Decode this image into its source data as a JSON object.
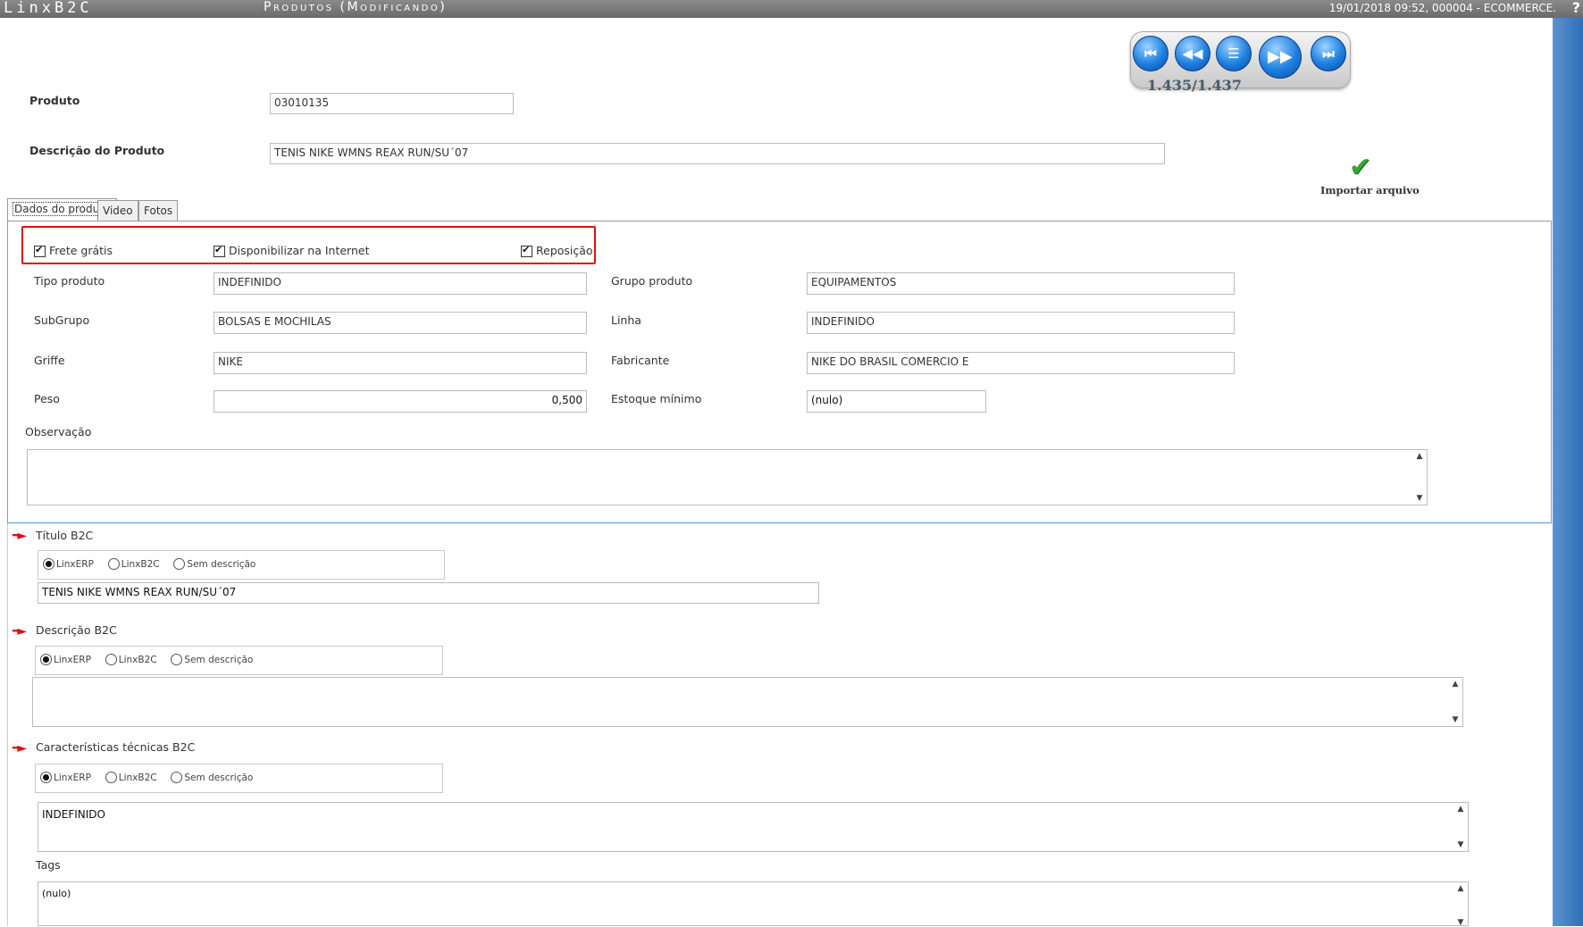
{
  "titlebar": {
    "app_name": "LinxB2C",
    "screen_title": "Produtos (Modificando)",
    "session_info": "19/01/2018 09:52, 000004 - ECOMMERCE.",
    "help_glyph": "?"
  },
  "navigation": {
    "first": "⏮",
    "previous": "◀◀",
    "list": "☰",
    "next": "▶▶",
    "last": "⏭",
    "record_counter": "1.435/1.437"
  },
  "header": {
    "produto_label": "Produto",
    "produto_value": "03010135",
    "descricao_label": "Descrição do Produto",
    "descricao_value": "TENIS NIKE WMNS REAX RUN/SU´07",
    "import_label": "Importar arquivo",
    "import_icon": "check-icon"
  },
  "tabs": [
    {
      "label": "Dados do produto"
    },
    {
      "label": "Video"
    },
    {
      "label": "Fotos"
    }
  ],
  "checkboxes": {
    "frete_gratis": "Frete grátis",
    "disponibilizar": "Disponibilizar na Internet",
    "reposicao": "Reposição"
  },
  "fields": {
    "tipo_produto_label": "Tipo produto",
    "tipo_produto_value": "INDEFINIDO",
    "grupo_produto_label": "Grupo produto",
    "grupo_produto_value": "EQUIPAMENTOS",
    "subgrupo_label": "SubGrupo",
    "subgrupo_value": "BOLSAS E MOCHILAS",
    "linha_label": "Linha",
    "linha_value": "INDEFINIDO",
    "griffe_label": "Griffe",
    "griffe_value": "NIKE",
    "fabricante_label": "Fabricante",
    "fabricante_value": "NIKE DO BRASIL COMERCIO E",
    "peso_label": "Peso",
    "peso_value": "0,500",
    "estoque_label": "Estoque mínimo",
    "estoque_value": "(nulo)",
    "observacao_label": "Observação"
  },
  "b2c": {
    "titulo_label": "Título B2C",
    "titulo_value": "TENIS NIKE WMNS REAX RUN/SU´07",
    "descricao_label": "Descrição B2C",
    "caracteristicas_label": "Características técnicas B2C",
    "caracteristicas_value": "INDEFINIDO",
    "tags_label": "Tags",
    "tags_value": "(nulo)",
    "radio_options": [
      "LinxERP",
      "LinxB2C",
      "Sem descrição"
    ]
  },
  "colors": {
    "highlight_border": "#e01010",
    "nav_blue": "#1d7fe0"
  }
}
